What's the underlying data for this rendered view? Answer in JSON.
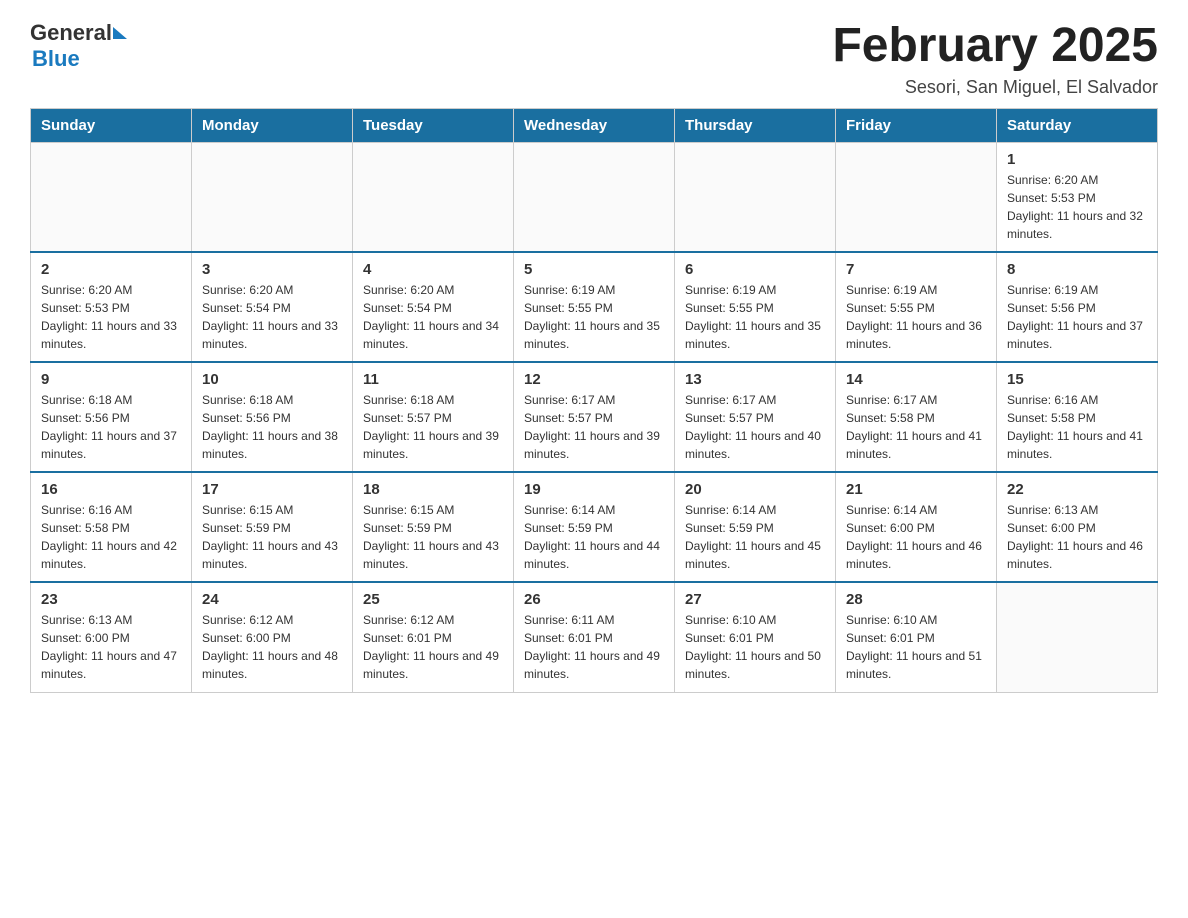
{
  "header": {
    "logo_general": "General",
    "logo_blue": "Blue",
    "title": "February 2025",
    "location": "Sesori, San Miguel, El Salvador"
  },
  "days_of_week": [
    "Sunday",
    "Monday",
    "Tuesday",
    "Wednesday",
    "Thursday",
    "Friday",
    "Saturday"
  ],
  "weeks": [
    {
      "days": [
        {
          "number": "",
          "sunrise": "",
          "sunset": "",
          "daylight": ""
        },
        {
          "number": "",
          "sunrise": "",
          "sunset": "",
          "daylight": ""
        },
        {
          "number": "",
          "sunrise": "",
          "sunset": "",
          "daylight": ""
        },
        {
          "number": "",
          "sunrise": "",
          "sunset": "",
          "daylight": ""
        },
        {
          "number": "",
          "sunrise": "",
          "sunset": "",
          "daylight": ""
        },
        {
          "number": "",
          "sunrise": "",
          "sunset": "",
          "daylight": ""
        },
        {
          "number": "1",
          "sunrise": "Sunrise: 6:20 AM",
          "sunset": "Sunset: 5:53 PM",
          "daylight": "Daylight: 11 hours and 32 minutes."
        }
      ]
    },
    {
      "days": [
        {
          "number": "2",
          "sunrise": "Sunrise: 6:20 AM",
          "sunset": "Sunset: 5:53 PM",
          "daylight": "Daylight: 11 hours and 33 minutes."
        },
        {
          "number": "3",
          "sunrise": "Sunrise: 6:20 AM",
          "sunset": "Sunset: 5:54 PM",
          "daylight": "Daylight: 11 hours and 33 minutes."
        },
        {
          "number": "4",
          "sunrise": "Sunrise: 6:20 AM",
          "sunset": "Sunset: 5:54 PM",
          "daylight": "Daylight: 11 hours and 34 minutes."
        },
        {
          "number": "5",
          "sunrise": "Sunrise: 6:19 AM",
          "sunset": "Sunset: 5:55 PM",
          "daylight": "Daylight: 11 hours and 35 minutes."
        },
        {
          "number": "6",
          "sunrise": "Sunrise: 6:19 AM",
          "sunset": "Sunset: 5:55 PM",
          "daylight": "Daylight: 11 hours and 35 minutes."
        },
        {
          "number": "7",
          "sunrise": "Sunrise: 6:19 AM",
          "sunset": "Sunset: 5:55 PM",
          "daylight": "Daylight: 11 hours and 36 minutes."
        },
        {
          "number": "8",
          "sunrise": "Sunrise: 6:19 AM",
          "sunset": "Sunset: 5:56 PM",
          "daylight": "Daylight: 11 hours and 37 minutes."
        }
      ]
    },
    {
      "days": [
        {
          "number": "9",
          "sunrise": "Sunrise: 6:18 AM",
          "sunset": "Sunset: 5:56 PM",
          "daylight": "Daylight: 11 hours and 37 minutes."
        },
        {
          "number": "10",
          "sunrise": "Sunrise: 6:18 AM",
          "sunset": "Sunset: 5:56 PM",
          "daylight": "Daylight: 11 hours and 38 minutes."
        },
        {
          "number": "11",
          "sunrise": "Sunrise: 6:18 AM",
          "sunset": "Sunset: 5:57 PM",
          "daylight": "Daylight: 11 hours and 39 minutes."
        },
        {
          "number": "12",
          "sunrise": "Sunrise: 6:17 AM",
          "sunset": "Sunset: 5:57 PM",
          "daylight": "Daylight: 11 hours and 39 minutes."
        },
        {
          "number": "13",
          "sunrise": "Sunrise: 6:17 AM",
          "sunset": "Sunset: 5:57 PM",
          "daylight": "Daylight: 11 hours and 40 minutes."
        },
        {
          "number": "14",
          "sunrise": "Sunrise: 6:17 AM",
          "sunset": "Sunset: 5:58 PM",
          "daylight": "Daylight: 11 hours and 41 minutes."
        },
        {
          "number": "15",
          "sunrise": "Sunrise: 6:16 AM",
          "sunset": "Sunset: 5:58 PM",
          "daylight": "Daylight: 11 hours and 41 minutes."
        }
      ]
    },
    {
      "days": [
        {
          "number": "16",
          "sunrise": "Sunrise: 6:16 AM",
          "sunset": "Sunset: 5:58 PM",
          "daylight": "Daylight: 11 hours and 42 minutes."
        },
        {
          "number": "17",
          "sunrise": "Sunrise: 6:15 AM",
          "sunset": "Sunset: 5:59 PM",
          "daylight": "Daylight: 11 hours and 43 minutes."
        },
        {
          "number": "18",
          "sunrise": "Sunrise: 6:15 AM",
          "sunset": "Sunset: 5:59 PM",
          "daylight": "Daylight: 11 hours and 43 minutes."
        },
        {
          "number": "19",
          "sunrise": "Sunrise: 6:14 AM",
          "sunset": "Sunset: 5:59 PM",
          "daylight": "Daylight: 11 hours and 44 minutes."
        },
        {
          "number": "20",
          "sunrise": "Sunrise: 6:14 AM",
          "sunset": "Sunset: 5:59 PM",
          "daylight": "Daylight: 11 hours and 45 minutes."
        },
        {
          "number": "21",
          "sunrise": "Sunrise: 6:14 AM",
          "sunset": "Sunset: 6:00 PM",
          "daylight": "Daylight: 11 hours and 46 minutes."
        },
        {
          "number": "22",
          "sunrise": "Sunrise: 6:13 AM",
          "sunset": "Sunset: 6:00 PM",
          "daylight": "Daylight: 11 hours and 46 minutes."
        }
      ]
    },
    {
      "days": [
        {
          "number": "23",
          "sunrise": "Sunrise: 6:13 AM",
          "sunset": "Sunset: 6:00 PM",
          "daylight": "Daylight: 11 hours and 47 minutes."
        },
        {
          "number": "24",
          "sunrise": "Sunrise: 6:12 AM",
          "sunset": "Sunset: 6:00 PM",
          "daylight": "Daylight: 11 hours and 48 minutes."
        },
        {
          "number": "25",
          "sunrise": "Sunrise: 6:12 AM",
          "sunset": "Sunset: 6:01 PM",
          "daylight": "Daylight: 11 hours and 49 minutes."
        },
        {
          "number": "26",
          "sunrise": "Sunrise: 6:11 AM",
          "sunset": "Sunset: 6:01 PM",
          "daylight": "Daylight: 11 hours and 49 minutes."
        },
        {
          "number": "27",
          "sunrise": "Sunrise: 6:10 AM",
          "sunset": "Sunset: 6:01 PM",
          "daylight": "Daylight: 11 hours and 50 minutes."
        },
        {
          "number": "28",
          "sunrise": "Sunrise: 6:10 AM",
          "sunset": "Sunset: 6:01 PM",
          "daylight": "Daylight: 11 hours and 51 minutes."
        },
        {
          "number": "",
          "sunrise": "",
          "sunset": "",
          "daylight": ""
        }
      ]
    }
  ]
}
